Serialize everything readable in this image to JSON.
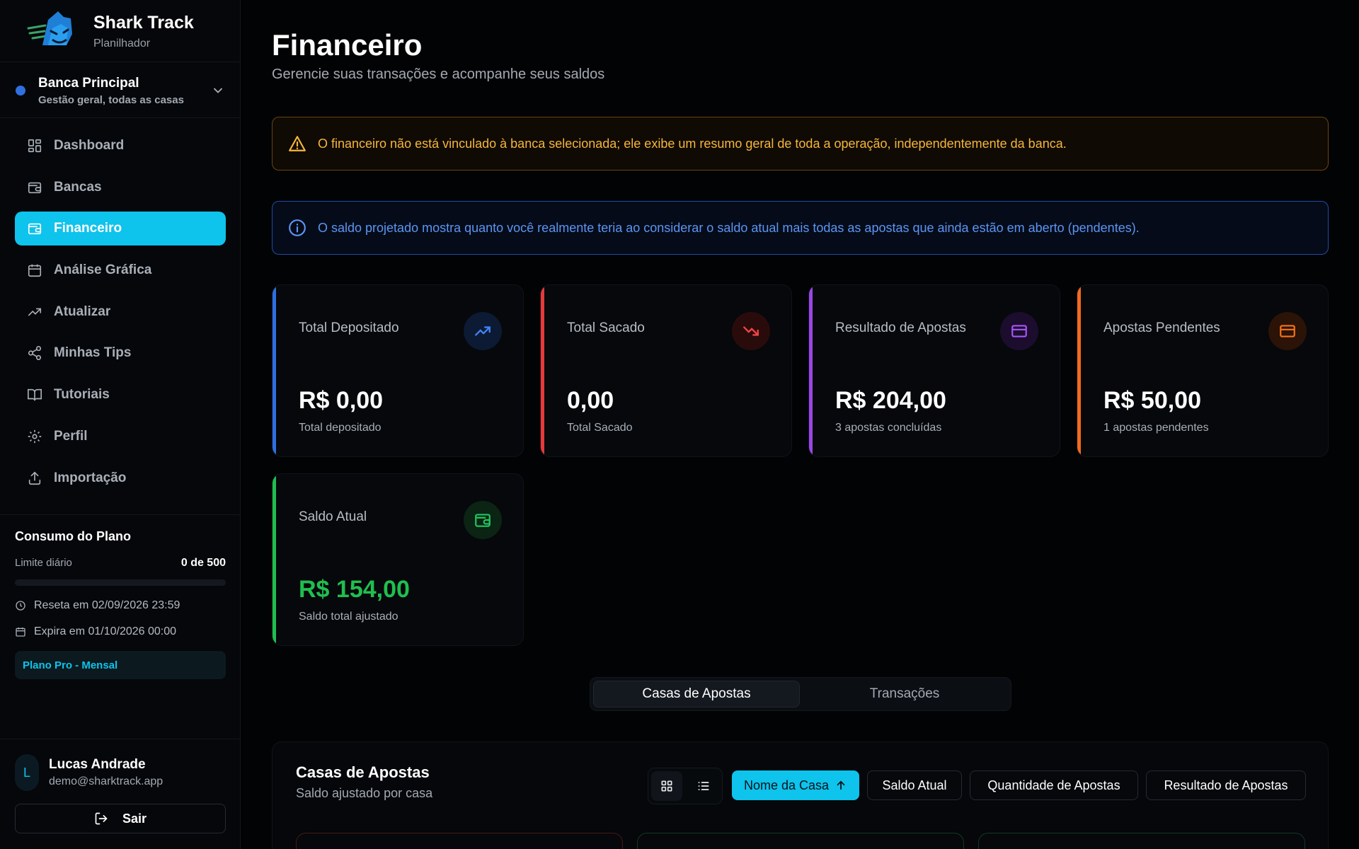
{
  "brand": {
    "title": "Shark Track",
    "subtitle": "Planilhador",
    "logo_icon": "shark-logo-icon"
  },
  "bank": {
    "name": "Banca Principal",
    "description": "Gestão geral, todas as casas",
    "dot_color": "#2f6fe0"
  },
  "nav": [
    {
      "label": "Dashboard",
      "icon": "dashboard-icon",
      "active": false
    },
    {
      "label": "Bancas",
      "icon": "wallet-icon",
      "active": false
    },
    {
      "label": "Financeiro",
      "icon": "wallet-icon",
      "active": true
    },
    {
      "label": "Análise Gráfica",
      "icon": "calendar-icon",
      "active": false
    },
    {
      "label": "Atualizar",
      "icon": "trending-up-icon",
      "active": false
    },
    {
      "label": "Minhas Tips",
      "icon": "share-icon",
      "active": false
    },
    {
      "label": "Tutoriais",
      "icon": "book-icon",
      "active": false
    },
    {
      "label": "Perfil",
      "icon": "gear-icon",
      "active": false
    },
    {
      "label": "Importação",
      "icon": "upload-icon",
      "active": false
    }
  ],
  "plan": {
    "title": "Consumo do Plano",
    "limit_label": "Limite diário",
    "limit_value": "0 de 500",
    "usage_fraction": 0,
    "reset_text": "Reseta em 02/09/2026 23:59",
    "expire_text": "Expira em 01/10/2026 00:00",
    "plan_name": "Plano Pro - Mensal"
  },
  "user": {
    "initial": "L",
    "name": "Lucas Andrade",
    "email": "demo@sharktrack.app",
    "logout_label": "Sair"
  },
  "page": {
    "title": "Financeiro",
    "subtitle": "Gerencie suas transações e acompanhe seus saldos"
  },
  "alerts": {
    "warning": "O financeiro não está vinculado à banca selecionada; ele exibe um resumo geral de toda a operação, independentemente da banca.",
    "info": "O saldo projetado mostra quanto você realmente teria ao considerar o saldo atual mais todas as apostas que ainda estão em aberto (pendentes)."
  },
  "cards": [
    {
      "title": "Total Depositado",
      "value": "R$ 0,00",
      "note": "Total depositado",
      "accent": "#2f6fe0",
      "icon": "trending-up-icon"
    },
    {
      "title": "Total Sacado",
      "value": "0,00",
      "note": "Total Sacado",
      "accent": "#e5393a",
      "icon": "trending-down-icon"
    },
    {
      "title": "Resultado de Apostas",
      "value": "R$ 204,00",
      "note": "3 apostas concluídas",
      "accent": "#9b46e8",
      "icon": "credit-card-icon"
    },
    {
      "title": "Apostas Pendentes",
      "value": "R$ 50,00",
      "note": "1 apostas pendentes",
      "accent": "#f26a1b",
      "icon": "credit-card-icon"
    },
    {
      "title": "Saldo Atual",
      "value": "R$ 154,00",
      "note": "Saldo total ajustado",
      "accent": "#1fbf4f",
      "icon": "wallet-icon"
    }
  ],
  "tabs": {
    "active": "Casas de Apostas",
    "inactive": "Transações"
  },
  "section": {
    "title": "Casas de Apostas",
    "subtitle": "Saldo ajustado por casa",
    "sort_buttons": [
      "Nome da Casa",
      "Saldo Atual",
      "Quantidade de Apostas",
      "Resultado de Apostas"
    ]
  }
}
